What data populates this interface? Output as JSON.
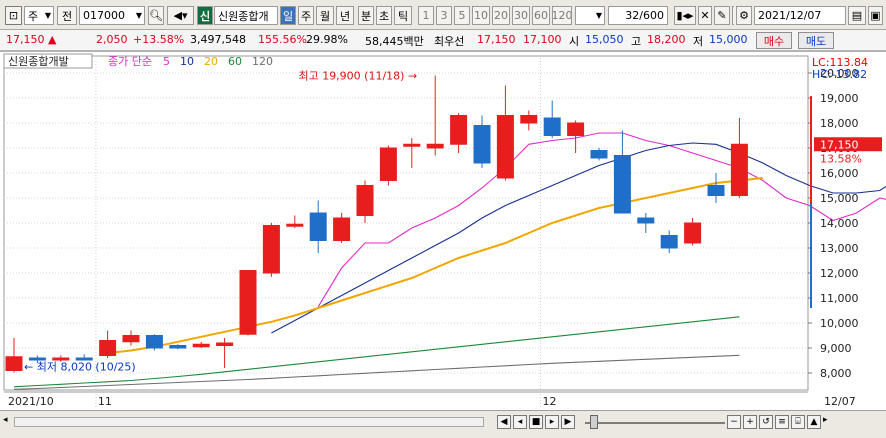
{
  "toolbar": {
    "market": "주",
    "type": "전",
    "code": "017000",
    "stock_name": "신원종합개",
    "periods": [
      "일",
      "주",
      "월",
      "년",
      "분",
      "초",
      "틱"
    ],
    "active_period": "일",
    "intervals": [
      "1",
      "3",
      "5",
      "10",
      "20",
      "30",
      "60",
      "120"
    ],
    "count": "32/600",
    "date": "2021/12/07",
    "shin_badge": "신"
  },
  "quote": {
    "price": "17,150",
    "change": "2,050",
    "change_pct": "+13.58%",
    "volume": "3,497,548",
    "volume_ratio": "155.56%",
    "turnover": "29.98%",
    "amount": "58,445백만",
    "top_label": "최우선",
    "ask": "17,150",
    "bid": "17,100",
    "open_label": "시",
    "open": "15,050",
    "high_label": "고",
    "high": "18,200",
    "low_label": "저",
    "low": "15,000",
    "buy_label": "매수",
    "sell_label": "매도"
  },
  "chart_legend": {
    "name": "신원종합개발",
    "indicator": "종가 단순",
    "ma_periods": [
      "5",
      "10",
      "20",
      "60",
      "120"
    ]
  },
  "chart_info": {
    "lc": "LC:113.84",
    "hc": "HC:-13.82",
    "current_price": "17,150",
    "current_pct": "13.58%",
    "max_label": "최고 19,900 (11/18)",
    "min_label": "최저 8,020 (10/25)"
  },
  "colors": {
    "up": "#e81e1e",
    "down": "#1f6fc9",
    "ma5": "#e02bc7",
    "ma10": "#172f8f",
    "ma20": "#f0a800",
    "ma60": "#1a8a3a",
    "ma120": "#6e6e6e"
  },
  "chart_data": {
    "type": "candlestick",
    "y_ticks": [
      8000,
      9000,
      10000,
      11000,
      12000,
      13000,
      14000,
      15000,
      16000,
      17000,
      18000,
      19000,
      20000
    ],
    "y_tick_labels": [
      "8,000",
      "9,000",
      "10,000",
      "11,000",
      "12,000",
      "13,000",
      "14,000",
      "15,000",
      "16,000",
      "17,000",
      "18,000",
      "19,000",
      "20,000"
    ],
    "ylim": [
      7400,
      20600
    ],
    "x_labels": [
      {
        "label": "2021/10",
        "index": 0
      },
      {
        "label": "11",
        "index": 4
      },
      {
        "label": "12",
        "index": 23
      },
      {
        "label": "12/07",
        "index": 32
      }
    ],
    "candles": [
      {
        "o": 8100,
        "h": 9400,
        "l": 8020,
        "c": 8650
      },
      {
        "o": 8600,
        "h": 8700,
        "l": 8400,
        "c": 8550
      },
      {
        "o": 8550,
        "h": 8700,
        "l": 8450,
        "c": 8600
      },
      {
        "o": 8600,
        "h": 8750,
        "l": 8500,
        "c": 8520
      },
      {
        "o": 8700,
        "h": 9700,
        "l": 8600,
        "c": 9300
      },
      {
        "o": 9250,
        "h": 9700,
        "l": 9100,
        "c": 9500
      },
      {
        "o": 9500,
        "h": 9550,
        "l": 8900,
        "c": 9000
      },
      {
        "o": 9100,
        "h": 9150,
        "l": 8950,
        "c": 9000
      },
      {
        "o": 9050,
        "h": 9250,
        "l": 9000,
        "c": 9150
      },
      {
        "o": 9100,
        "h": 9400,
        "l": 8200,
        "c": 9200
      },
      {
        "o": 9550,
        "h": 12100,
        "l": 9500,
        "c": 12100
      },
      {
        "o": 12000,
        "h": 14000,
        "l": 11850,
        "c": 13900
      },
      {
        "o": 13900,
        "h": 14300,
        "l": 13800,
        "c": 13950
      },
      {
        "o": 14400,
        "h": 14900,
        "l": 12800,
        "c": 13300
      },
      {
        "o": 13300,
        "h": 14400,
        "l": 13200,
        "c": 14200
      },
      {
        "o": 14300,
        "h": 15700,
        "l": 14000,
        "c": 15500
      },
      {
        "o": 15700,
        "h": 17100,
        "l": 15500,
        "c": 17000
      },
      {
        "o": 17150,
        "h": 17400,
        "l": 16200,
        "c": 17150
      },
      {
        "o": 17000,
        "h": 19900,
        "l": 16700,
        "c": 17150
      },
      {
        "o": 17150,
        "h": 18400,
        "l": 16800,
        "c": 18300
      },
      {
        "o": 17900,
        "h": 18300,
        "l": 16200,
        "c": 16400
      },
      {
        "o": 15800,
        "h": 19500,
        "l": 15700,
        "c": 18300
      },
      {
        "o": 18000,
        "h": 18500,
        "l": 17700,
        "c": 18300
      },
      {
        "o": 18200,
        "h": 18900,
        "l": 17400,
        "c": 17500
      },
      {
        "o": 17500,
        "h": 18100,
        "l": 16800,
        "c": 18000
      },
      {
        "o": 16900,
        "h": 17000,
        "l": 16500,
        "c": 16600
      },
      {
        "o": 16700,
        "h": 17700,
        "l": 14500,
        "c": 14400
      },
      {
        "o": 14200,
        "h": 14400,
        "l": 13600,
        "c": 14000
      },
      {
        "o": 13500,
        "h": 13700,
        "l": 12800,
        "c": 13000
      },
      {
        "o": 13200,
        "h": 14200,
        "l": 13100,
        "c": 14000
      },
      {
        "o": 15500,
        "h": 16000,
        "l": 14800,
        "c": 15100
      },
      {
        "o": 15100,
        "h": 18200,
        "l": 15000,
        "c": 17150
      }
    ],
    "ma_start": [
      13,
      11,
      4,
      0,
      0
    ],
    "ma5": [
      10650,
      12200,
      13200,
      13200,
      13800,
      14200,
      14700,
      15400,
      16200,
      17150,
      17300,
      17400,
      17600,
      17600,
      17300,
      17100,
      16800,
      16500,
      16200,
      15700,
      15000,
      14700,
      14100,
      14400,
      15000,
      14800
    ],
    "ma10": [
      9600,
      10100,
      10600,
      11100,
      11600,
      12100,
      12600,
      13100,
      13600,
      14200,
      14700,
      15100,
      15500,
      15900,
      16300,
      16600,
      16900,
      17100,
      17200,
      17150,
      16800,
      16400,
      15900,
      15500,
      15200,
      15200,
      15300,
      15900
    ],
    "ma20": [
      8800,
      8900,
      9050,
      9250,
      9450,
      9650,
      9850,
      10050,
      10300,
      10600,
      10900,
      11200,
      11500,
      11800,
      12200,
      12600,
      12900,
      13200,
      13600,
      14000,
      14300,
      14600,
      14800,
      15000,
      15200,
      15400,
      15600,
      15700,
      15800
    ],
    "ma60": [
      7450,
      7500,
      7550,
      7600,
      7650,
      7700,
      7780,
      7860,
      7950,
      8050,
      8150,
      8250,
      8350,
      8450,
      8550,
      8650,
      8750,
      8850,
      8950,
      9050,
      9150,
      9250,
      9350,
      9450,
      9550,
      9650,
      9750,
      9850,
      9950,
      10050,
      10150,
      10250
    ],
    "ma120": [
      7350,
      7380,
      7420,
      7460,
      7500,
      7540,
      7580,
      7620,
      7660,
      7700,
      7740,
      7790,
      7840,
      7890,
      7940,
      7990,
      8040,
      8090,
      8140,
      8190,
      8240,
      8290,
      8340,
      8390,
      8430,
      8470,
      8510,
      8550,
      8590,
      8630,
      8670,
      8710
    ]
  }
}
